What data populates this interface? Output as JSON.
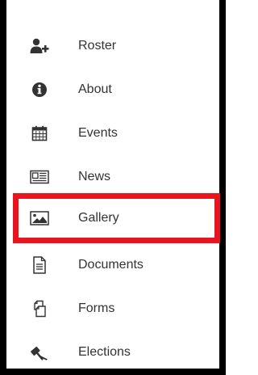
{
  "menu": {
    "items": [
      {
        "label": "Roster",
        "icon": "add-user-icon"
      },
      {
        "label": "About",
        "icon": "info-circle-icon"
      },
      {
        "label": "Events",
        "icon": "calendar-icon"
      },
      {
        "label": "News",
        "icon": "newspaper-icon"
      },
      {
        "label": "Gallery",
        "icon": "image-icon"
      },
      {
        "label": "Documents",
        "icon": "document-icon"
      },
      {
        "label": "Forms",
        "icon": "forms-icon"
      },
      {
        "label": "Elections",
        "icon": "gavel-icon"
      }
    ],
    "highlighted_item": "Gallery"
  },
  "colors": {
    "text": "#333333",
    "highlight_border": "#e8141e",
    "frame": "#000000"
  }
}
